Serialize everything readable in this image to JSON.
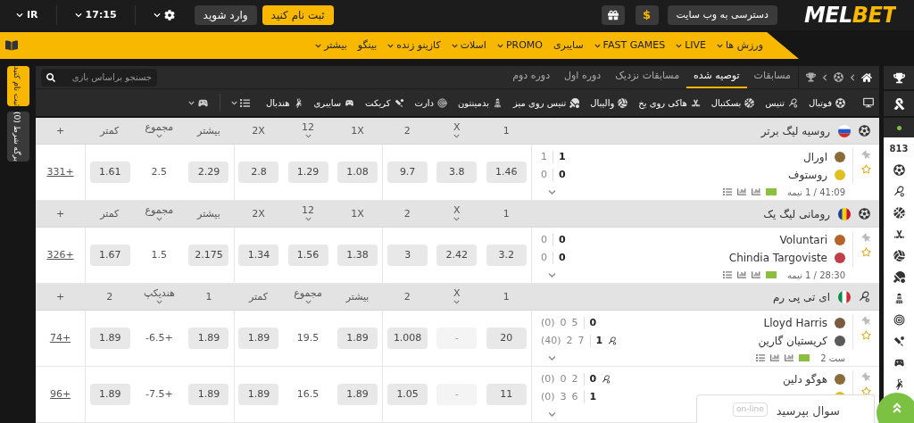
{
  "top_bar": {
    "language": "IR",
    "time": "17:15",
    "login": "وارد شوید",
    "register": "ثبت نام کنید",
    "site_access": "دسترسی به وب سایت",
    "currency": "$",
    "logo": "MELBET"
  },
  "nav": [
    {
      "label": "ورزش ها",
      "menu": true
    },
    {
      "label": "LIVE",
      "menu": true
    },
    {
      "label": "FAST GAMES",
      "menu": true
    },
    {
      "label": "سایبری",
      "menu": false
    },
    {
      "label": "PROMO",
      "menu": true
    },
    {
      "label": "اسلات",
      "menu": true
    },
    {
      "label": "کازینو زنده",
      "menu": true
    },
    {
      "label": "بینگو",
      "menu": false
    },
    {
      "label": "بیشتر",
      "menu": true
    }
  ],
  "side_tabs": [
    {
      "label": "ثبت نام کنید",
      "kind": "accent"
    },
    {
      "label": "برگه شرط (0)",
      "kind": "plain"
    }
  ],
  "tabs": [
    {
      "label": "مسابقات",
      "selected": false
    },
    {
      "label": "توصیه شده",
      "selected": true
    },
    {
      "label": "مسابقات نزدیک",
      "selected": false
    },
    {
      "label": "دوره اول",
      "selected": false
    },
    {
      "label": "دوره دوم",
      "selected": false
    }
  ],
  "search": {
    "placeholder": "جستجو براساس بازی"
  },
  "sports": [
    "فوتبال",
    "تنیس",
    "بسکتبال",
    "هاکی روی یخ",
    "والیبال",
    "تنیس روی میز",
    "بدمینتون",
    "دارت",
    "کریکت",
    "سایبری",
    "هندبال"
  ],
  "live_count": "813",
  "leagues": [
    {
      "name": "روسیه لیگ برتر",
      "columns": [
        {
          "label": "1",
          "menu": false
        },
        {
          "label": "X",
          "menu": true
        },
        {
          "label": "2",
          "menu": false
        },
        {
          "label": "1X",
          "menu": false
        },
        {
          "label": "12",
          "menu": true
        },
        {
          "label": "2X",
          "menu": false
        },
        {
          "label": "بیشتر",
          "menu": false
        },
        {
          "label": "مجموع",
          "menu": true
        },
        {
          "label": "کمتر",
          "menu": false
        },
        {
          "label": "+",
          "menu": false
        }
      ],
      "matches": [
        {
          "teams": [
            {
              "name": "اورال",
              "points": [
                "1"
              ],
              "total": "1",
              "serving": false
            },
            {
              "name": "روستوف",
              "points": [
                "0"
              ],
              "total": "0",
              "serving": false
            }
          ],
          "info": "41:09 / 1 نیمه",
          "cells": [
            {
              "kind": "odd",
              "text": "1.46"
            },
            {
              "kind": "odd",
              "text": "3.8"
            },
            {
              "kind": "odd",
              "text": "9.7"
            },
            {
              "kind": "odd",
              "text": "1.08"
            },
            {
              "kind": "odd",
              "text": "1.29"
            },
            {
              "kind": "odd",
              "text": "2.8"
            },
            {
              "kind": "odd",
              "text": "2.29"
            },
            {
              "kind": "line",
              "text": "2.5"
            },
            {
              "kind": "odd",
              "text": "1.61"
            },
            {
              "kind": "more",
              "text": "331+"
            }
          ]
        }
      ]
    },
    {
      "name": "رومانی لیگ یک",
      "columns": [
        {
          "label": "1",
          "menu": false
        },
        {
          "label": "X",
          "menu": true
        },
        {
          "label": "2",
          "menu": false
        },
        {
          "label": "1X",
          "menu": false
        },
        {
          "label": "12",
          "menu": true
        },
        {
          "label": "2X",
          "menu": false
        },
        {
          "label": "بیشتر",
          "menu": false
        },
        {
          "label": "مجموع",
          "menu": true
        },
        {
          "label": "کمتر",
          "menu": false
        },
        {
          "label": "+",
          "menu": false
        }
      ],
      "matches": [
        {
          "teams": [
            {
              "name": "Voluntari",
              "points": [
                "0"
              ],
              "total": "0",
              "serving": false
            },
            {
              "name": "Chindia Targoviste",
              "points": [
                "0"
              ],
              "total": "0",
              "serving": false
            }
          ],
          "info": "28:30 / 1 نیمه",
          "cells": [
            {
              "kind": "odd",
              "text": "3.2"
            },
            {
              "kind": "odd",
              "text": "2.42"
            },
            {
              "kind": "odd",
              "text": "3"
            },
            {
              "kind": "odd",
              "text": "1.38"
            },
            {
              "kind": "odd",
              "text": "1.56"
            },
            {
              "kind": "odd",
              "text": "1.34"
            },
            {
              "kind": "odd",
              "text": "2.175"
            },
            {
              "kind": "line",
              "text": "1.5"
            },
            {
              "kind": "odd",
              "text": "1.67"
            },
            {
              "kind": "more",
              "text": "326+"
            }
          ]
        }
      ]
    },
    {
      "name": "ای تی پی رم",
      "columns": [
        {
          "label": "1",
          "menu": false
        },
        {
          "label": "X",
          "menu": true
        },
        {
          "label": "2",
          "menu": false
        },
        {
          "label": "بیشتر",
          "menu": false
        },
        {
          "label": "مجموع",
          "menu": true
        },
        {
          "label": "کمتر",
          "menu": false
        },
        {
          "label": "1",
          "menu": false
        },
        {
          "label": "هندیکپ",
          "menu": true
        },
        {
          "label": "2",
          "menu": false
        },
        {
          "label": "+",
          "menu": false
        }
      ],
      "matches": [
        {
          "teams": [
            {
              "name": "Lloyd Harris",
              "points": [
                "5",
                "0",
                "(0)"
              ],
              "total": "0",
              "serving": false
            },
            {
              "name": "کریستیان گارین",
              "points": [
                "7",
                "2",
                "(40)"
              ],
              "total": "1",
              "serving": true
            }
          ],
          "info": "ست 2",
          "cells": [
            {
              "kind": "odd",
              "text": "20"
            },
            {
              "kind": "locked",
              "text": "-"
            },
            {
              "kind": "odd",
              "text": "1.008"
            },
            {
              "kind": "odd",
              "text": "1.89"
            },
            {
              "kind": "line",
              "text": "19.5"
            },
            {
              "kind": "odd",
              "text": "1.89"
            },
            {
              "kind": "odd",
              "text": "1.89"
            },
            {
              "kind": "line",
              "text": "-6.5+"
            },
            {
              "kind": "odd",
              "text": "1.89"
            },
            {
              "kind": "more",
              "text": "74+"
            }
          ]
        },
        {
          "teams": [
            {
              "name": "هوگو دلین",
              "points": [
                "2",
                "0",
                "(0)"
              ],
              "total": "0",
              "serving": true
            },
            {
              "points": [
                "6",
                "3",
                "(0)"
              ],
              "total": "1",
              "serving": false
            }
          ],
          "cells": [
            {
              "kind": "odd",
              "text": "11"
            },
            {
              "kind": "locked",
              "text": "-"
            },
            {
              "kind": "odd",
              "text": "1.05"
            },
            {
              "kind": "odd",
              "text": "1.89"
            },
            {
              "kind": "line",
              "text": "16.5"
            },
            {
              "kind": "odd",
              "text": "1.89"
            },
            {
              "kind": "odd",
              "text": "1.89"
            },
            {
              "kind": "line",
              "text": "-7.5+"
            },
            {
              "kind": "odd",
              "text": "1.89"
            },
            {
              "kind": "more",
              "text": "96+"
            }
          ]
        }
      ]
    }
  ],
  "chat": {
    "label": "سوال بپرسید",
    "status": "on-line"
  }
}
